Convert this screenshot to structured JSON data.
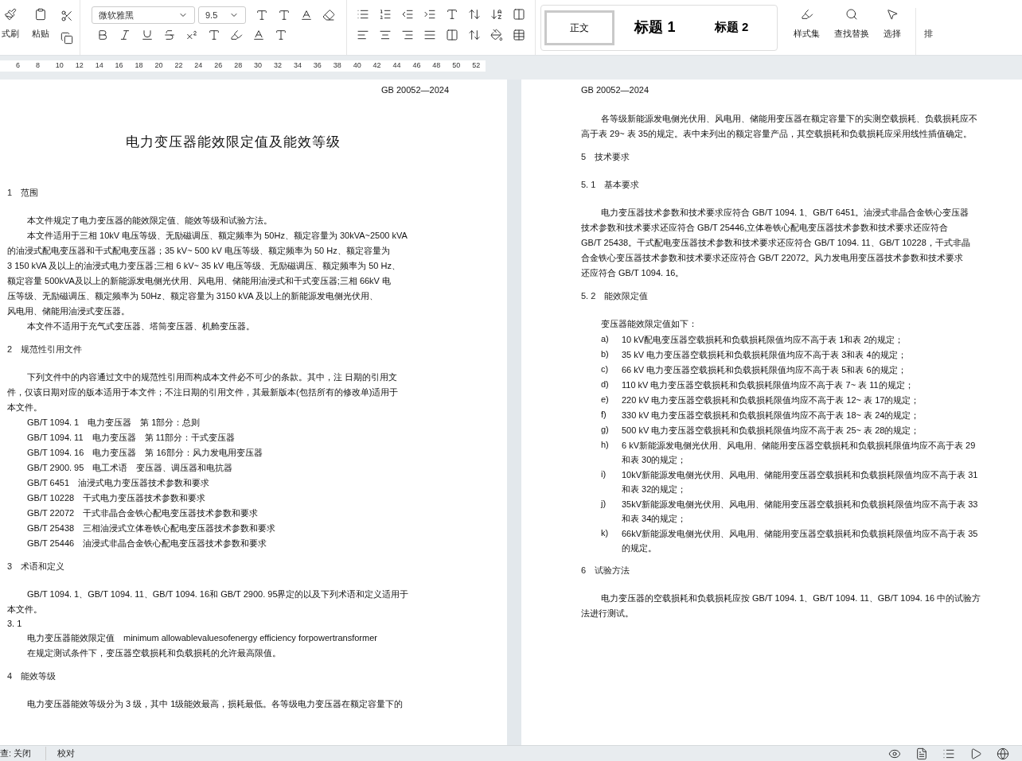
{
  "ribbon": {
    "cut_left": [
      "式刷",
      "粘贴"
    ],
    "font": "微软雅黑",
    "size": "9.5",
    "styles": [
      {
        "label": "正文",
        "selected": true
      },
      {
        "label": "标题 1",
        "selected": false
      },
      {
        "label": "标题 2",
        "selected": false
      }
    ],
    "style_set": "样式集",
    "find": "查找替换",
    "select": "选择",
    "cut_right": "排"
  },
  "ruler": [
    "6",
    "8",
    "10",
    "12",
    "14",
    "16",
    "18",
    "20",
    "22",
    "24",
    "26",
    "28",
    "30",
    "32",
    "34",
    "36",
    "38",
    "40",
    "42",
    "44",
    "46",
    "48",
    "50",
    "52"
  ],
  "left_page": {
    "header": "GB 20052—2024",
    "blocks": [
      {
        "kind": "title",
        "lines": [
          "电力变压器能效限定值及能效等级"
        ]
      },
      {
        "kind": "heading",
        "lines": [
          "1　范围"
        ]
      },
      {
        "kind": "para",
        "lines": [
          "本文件规定了电力变压器的能效限定值、能效等级和试验方法。"
        ]
      },
      {
        "kind": "para",
        "lines": [
          "本文件适用于三相 10kV 电压等级、无励磁调压、额定频率为 50Hz、额定容量为 30kVA~2500 kVA",
          "的油浸式配电变压器和干式配电变压器；35 kV~ 500 kV 电压等级、额定频率为 50 Hz、额定容量为",
          "3 150 kVA 及以上的油浸式电力变压器;三相 6 kV~ 35 kV 电压等级、无励磁调压、额定频率为 50 Hz、",
          "额定容量 500kVA及以上的新能源发电侧光伏用、风电用、储能用油浸式和干式变压器;三相 66kV 电",
          "压等级、无励磁调压、额定频率为 50Hz、额定容量为 3150 kVA 及以上的新能源发电侧光伏用、",
          "风电用、储能用油浸式变压器。"
        ]
      },
      {
        "kind": "para",
        "lines": [
          "本文件不适用于充气式变压器、塔筒变压器、机舱变压器。"
        ]
      },
      {
        "kind": "heading",
        "lines": [
          "2　规范性引用文件"
        ]
      },
      {
        "kind": "para",
        "lines": [
          "下列文件中的内容通过文中的规范性引用而构成本文件必不可少的条款。其中，注 日期的引用文",
          "件，仅该日期对应的版本适用于本文件；不注日期的引用文件，其最新版本(包括所有的修改单)适用于",
          "本文件。"
        ]
      },
      {
        "kind": "ref",
        "lines": [
          "GB/T 1094. 1　电力变压器　第 1部分：总则"
        ]
      },
      {
        "kind": "ref",
        "lines": [
          "GB/T 1094. 11　电力变压器　第 11部分：干式变压器"
        ]
      },
      {
        "kind": "ref",
        "lines": [
          "GB/T 1094. 16　电力变压器　第 16部分：风力发电用变压器"
        ]
      },
      {
        "kind": "ref",
        "lines": [
          "GB/T 2900. 95　电工术语　变压器、调压器和电抗器"
        ]
      },
      {
        "kind": "ref",
        "lines": [
          "GB/T 6451　油浸式电力变压器技术参数和要求"
        ]
      },
      {
        "kind": "ref",
        "lines": [
          "GB/T 10228　干式电力变压器技术参数和要求"
        ]
      },
      {
        "kind": "ref",
        "lines": [
          "GB/T 22072　干式非晶合金铁心配电变压器技术参数和要求"
        ]
      },
      {
        "kind": "ref",
        "lines": [
          "GB/T 25438　三相油浸式立体卷铁心配电变压器技术参数和要求"
        ]
      },
      {
        "kind": "ref",
        "lines": [
          "GB/T 25446　油浸式非晶合金铁心配电变压器技术参数和要求"
        ]
      },
      {
        "kind": "heading",
        "lines": [
          "3　术语和定义"
        ]
      },
      {
        "kind": "para",
        "lines": [
          "GB/T 1094. 1、GB/T 1094. 11、GB/T 1094. 16和 GB/T 2900. 95界定的以及下列术语和定义适用于",
          "本文件。"
        ]
      },
      {
        "kind": "number",
        "lines": [
          "3. 1"
        ]
      },
      {
        "kind": "ref",
        "lines": [
          "电力变压器能效限定值　minimum allowablevaluesofenergy efficiency forpowertransformer"
        ]
      },
      {
        "kind": "ref",
        "lines": [
          "在规定测试条件下，变压器空载损耗和负载损耗的允许最高限值。"
        ]
      },
      {
        "kind": "heading",
        "lines": [
          "4　能效等级"
        ]
      },
      {
        "kind": "para",
        "lines": [
          "电力变压器能效等级分为 3 级，其中 1级能效最高，损耗最低。各等级电力变压器在额定容量下的"
        ]
      }
    ]
  },
  "right_page": {
    "header": "GB 20052—2024",
    "blocks": [
      {
        "kind": "para",
        "lines": [
          "各等级新能源发电侧光伏用、风电用、储能用变压器在额定容量下的实测空载损耗、负载损耗应不",
          "高于表 29~ 表 35的规定。表中未列出的额定容量产品，其空载损耗和负载损耗应采用线性插值确定。"
        ]
      },
      {
        "kind": "heading",
        "lines": [
          "5　技术要求"
        ]
      },
      {
        "kind": "heading",
        "lines": [
          "5. 1　基本要求"
        ]
      },
      {
        "kind": "para",
        "lines": [
          "电力变压器技术参数和技术要求应符合 GB/T 1094. 1、GB/T 6451。油浸式非晶合金铁心变压器",
          "技术参数和技术要求还应符合 GB/T 25446,立体卷铁心配电变压器技术参数和技术要求还应符合",
          "GB/T 25438。干式配电变压器技术参数和技术要求还应符合 GB/T 1094. 11、GB/T 10228，干式非晶",
          "合金铁心变压器技术参数和技术要求还应符合 GB/T 22072。风力发电用变压器技术参数和技术要求",
          "还应符合 GB/T 1094. 16。"
        ]
      },
      {
        "kind": "heading",
        "lines": [
          "5. 2　能效限定值"
        ]
      },
      {
        "kind": "para",
        "lines": [
          "变压器能效限定值如下："
        ]
      },
      {
        "kind": "item",
        "label": "a)",
        "lines": [
          "10 kV配电变压器空载损耗和负载损耗限值均应不高于表 1和表 2的规定；"
        ]
      },
      {
        "kind": "item",
        "label": "b)",
        "lines": [
          "35 kV 电力变压器空载损耗和负载损耗限值均应不高于表 3和表 4的规定；"
        ]
      },
      {
        "kind": "item",
        "label": "c)",
        "lines": [
          "66 kV 电力变压器空载损耗和负载损耗限值均应不高于表 5和表 6的规定；"
        ]
      },
      {
        "kind": "item",
        "label": "d)",
        "lines": [
          "110 kV 电力变压器空载损耗和负载损耗限值均应不高于表 7~ 表 11的规定；"
        ]
      },
      {
        "kind": "item",
        "label": "e)",
        "lines": [
          "220 kV 电力变压器空载损耗和负载损耗限值均应不高于表 12~ 表 17的规定；"
        ]
      },
      {
        "kind": "item",
        "label": "f)",
        "lines": [
          "330 kV 电力变压器空载损耗和负载损耗限值均应不高于表 18~ 表 24的规定；"
        ]
      },
      {
        "kind": "item",
        "label": "g)",
        "lines": [
          "500 kV 电力变压器空载损耗和负载损耗限值均应不高于表 25~ 表 28的规定；"
        ]
      },
      {
        "kind": "item",
        "label": "h)",
        "lines": [
          "6 kV新能源发电侧光伏用、风电用、储能用变压器空载损耗和负载损耗限值均应不高于表 29",
          "和表 30的规定；"
        ]
      },
      {
        "kind": "item",
        "label": "i)",
        "lines": [
          "10kV新能源发电侧光伏用、风电用、储能用变压器空载损耗和负载损耗限值均应不高于表 31",
          "和表 32的规定；"
        ]
      },
      {
        "kind": "item",
        "label": "j)",
        "lines": [
          "35kV新能源发电侧光伏用、风电用、储能用变压器空载损耗和负载损耗限值均应不高于表 33",
          "和表 34的规定；"
        ]
      },
      {
        "kind": "item",
        "label": "k)",
        "lines": [
          "66kV新能源发电侧光伏用、风电用、储能用变压器空载损耗和负载损耗限值均应不高于表 35",
          "的规定。"
        ]
      },
      {
        "kind": "heading",
        "lines": [
          "6　试验方法"
        ]
      },
      {
        "kind": "para",
        "lines": [
          "电力变压器的空载损耗和负载损耗应按 GB/T 1094. 1、GB/T 1094. 11、GB/T 1094. 16 中的试验方",
          "法进行测试。"
        ]
      }
    ]
  },
  "status_bar": {
    "left": "查: 关闭",
    "proof": "校对"
  }
}
